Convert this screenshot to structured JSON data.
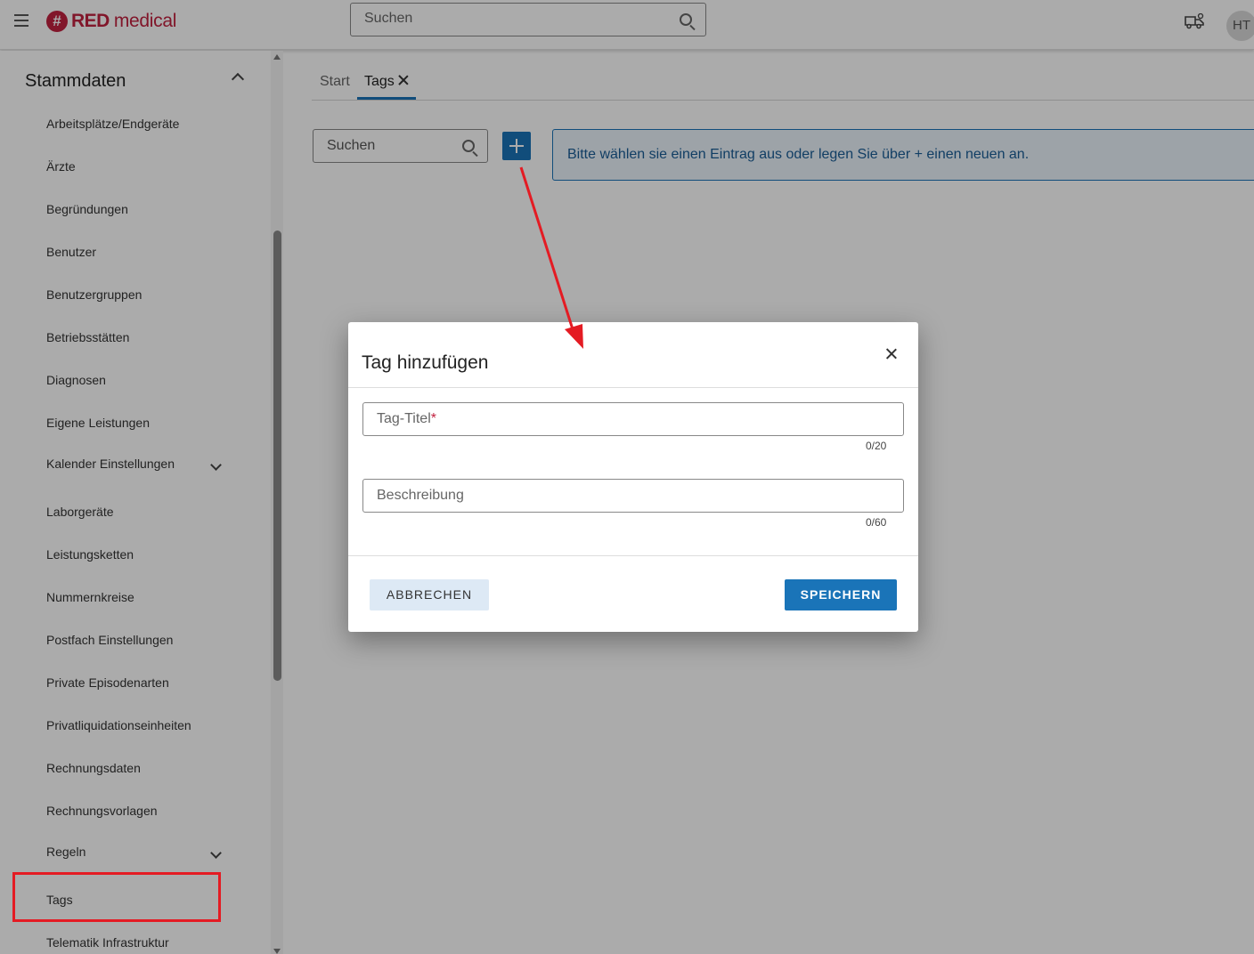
{
  "header": {
    "logo_badge": "#",
    "logo_red": "RED",
    "logo_medical": "medical",
    "search_placeholder": "Suchen",
    "avatar_initials": "HT"
  },
  "sidebar": {
    "heading": "Stammdaten",
    "items": [
      {
        "label": "Arbeitsplätze/Endgeräte"
      },
      {
        "label": "Ärzte"
      },
      {
        "label": "Begründungen"
      },
      {
        "label": "Benutzer"
      },
      {
        "label": "Benutzergruppen"
      },
      {
        "label": "Betriebsstätten"
      },
      {
        "label": "Diagnosen"
      },
      {
        "label": "Eigene Leistungen"
      },
      {
        "label": "Kalender Einstellungen",
        "expandable": true
      },
      {
        "label": "Laborgeräte"
      },
      {
        "label": "Leistungsketten"
      },
      {
        "label": "Nummernkreise"
      },
      {
        "label": "Postfach Einstellungen"
      },
      {
        "label": "Private Episodenarten"
      },
      {
        "label": "Privatliquidationseinheiten"
      },
      {
        "label": "Rechnungsdaten"
      },
      {
        "label": "Rechnungsvorlagen"
      },
      {
        "label": "Regeln",
        "expandable": true
      },
      {
        "label": "Tags",
        "highlighted": true
      },
      {
        "label": "Telematik Infrastruktur"
      }
    ]
  },
  "main": {
    "tabs": [
      {
        "label": "Start",
        "active": false
      },
      {
        "label": "Tags",
        "active": true,
        "closable": true
      }
    ],
    "list_search_placeholder": "Suchen",
    "info_text": "Bitte wählen sie einen Eintrag aus oder legen Sie über + einen neuen an."
  },
  "dialog": {
    "title": "Tag hinzufügen",
    "title_field_label": "Tag-Titel",
    "title_field_required_mark": "*",
    "title_counter": "0/20",
    "description_field_label": "Beschreibung",
    "description_counter": "0/60",
    "cancel_label": "ABBRECHEN",
    "save_label": "SPEICHERN"
  },
  "colors": {
    "brand": "#c1213f",
    "primary": "#1a74b8",
    "annotation": "#e41b23"
  }
}
